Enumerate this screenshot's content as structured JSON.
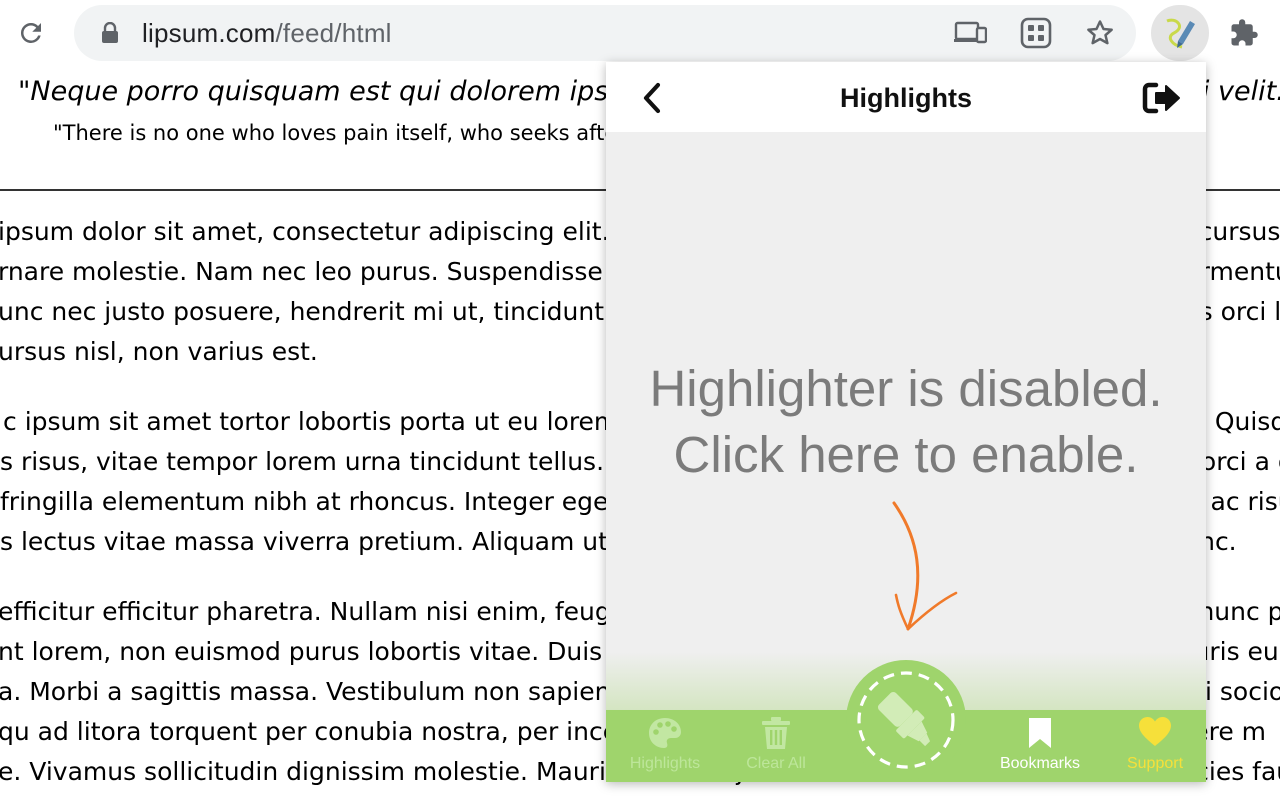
{
  "browser": {
    "url_host": "lipsum.com",
    "url_path": "/feed/html",
    "icons": [
      "reload-icon",
      "lock-icon",
      "cast-icon",
      "tab-grid-icon",
      "star-icon",
      "highlighter-extension-icon",
      "puzzle-icon"
    ]
  },
  "page": {
    "quote_latin": "\"Neque porro quisquam est qui dolorem ipsum quia dolor sit amet, consectetur, adipisci velit...\"",
    "quote_english": "\"There is no one who loves pain itself, who seeks after it and wants to have it, simply because it is pain...\"",
    "paragraphs": [
      [
        "ipsum dolor sit amet, consectetur adipiscing elit. Nulla facilisi. Integer ac arcu at justo pharetra cursus. Curabitur a",
        "rnare molestie. Nam nec leo purus. Suspendisse potenti. Fusce dapibus, sapien in malesuada fermentum, lorem rh",
        "unc nec justo posuere, hendrerit mi ut, tincidunt ligula. Vestibulum ante ipsum primis in faucibus orci luctus. Phase",
        "ursus nisl, non varius est."
      ],
      [
        "c ipsum sit amet tortor lobortis porta ut eu lorem. Donec vitae ligula a nisi scelerisque pharetra. Quisque, n",
        "s risus, vitae tempor lorem urna tincidunt tellus. Sed commodo, velit vel ultricies faucibus, erat orci a orc",
        "fringilla elementum nibh at rhoncus. Integer eget purus vel lacus pharetra ullamcorper id ac est ac risus.",
        "s lectus vitae massa viverra pretium. Aliquam ut lorem semper, iaculis metus et, fermentum nunc."
      ],
      [
        "efficitur efficitur pharetra. Nullam nisi enim, feugiat in ultricies sed, consectetur vitae lorem. Ut nunc p",
        "nt lorem, non euismod purus lobortis vitae. Duis vitae magna quis lectus tincidunt vehicula. Mauris eu s",
        "a. Morbi a sagittis massa. Vestibulum non sapien non risus semper accumsan. Class aptent taciti sociosqu aptent",
        "qu ad litora torquent per conubia nostra, per inceptos himenaeos. Nunc non tellus lacinia, posuere m",
        "e. Vivamus sollicitudin dignissim molestie. Mauris vel ante justo. Nam vel ex a elit faucibus ultricies faucibus"
      ]
    ]
  },
  "popup": {
    "title": "Highlights",
    "disabled_line1": "Highlighter is disabled.",
    "disabled_line2": "Click here to enable.",
    "nav": {
      "highlights": "Highlights",
      "clear_all": "Clear All",
      "bookmarks": "Bookmarks",
      "support": "Support"
    },
    "colors": {
      "bar": "#9fd46c",
      "muted_label": "#bde69a",
      "support": "#f6e03a",
      "arrow": "#f07a2a"
    }
  }
}
